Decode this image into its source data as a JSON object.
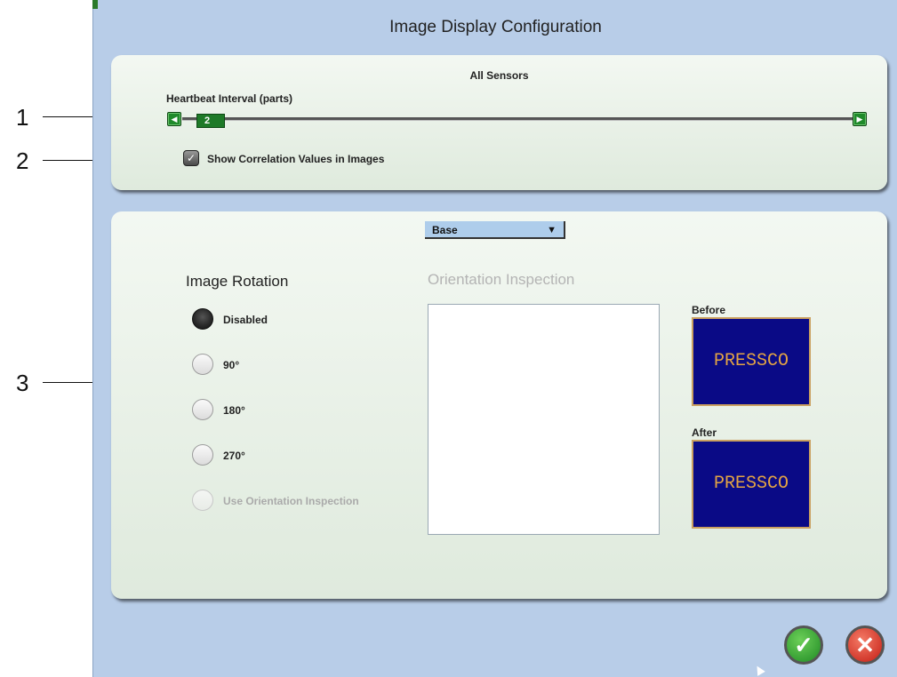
{
  "callouts": [
    "1",
    "2",
    "3"
  ],
  "dialog": {
    "title": "Image Display Configuration"
  },
  "sensors": {
    "section_title": "All Sensors",
    "heartbeat_label": "Heartbeat Interval (parts)",
    "heartbeat_value": "2",
    "show_correlation_label": "Show Correlation Values in Images",
    "show_correlation_checked": true
  },
  "rotation": {
    "dropdown_value": "Base",
    "heading": "Image Rotation",
    "options": [
      "Disabled",
      "90°",
      "180°",
      "270°",
      "Use Orientation Inspection"
    ],
    "selected": "Disabled",
    "orientation_heading": "Orientation Inspection",
    "before_label": "Before",
    "after_label": "After",
    "before_text": "PRESSCO",
    "after_text": "PRESSCO"
  },
  "colors": {
    "dialog_bg": "#b8cde8",
    "panel_bg": "#e8f0e6",
    "slider_green": "#1f8a2a",
    "image_bg": "#0a0a86",
    "image_text": "#e3a444",
    "ok_green": "#2e9a2a",
    "cancel_red": "#d42a1e"
  },
  "icons": {
    "slider_left": "chevron-left-icon",
    "slider_right": "chevron-right-icon",
    "ok": "check-icon",
    "cancel": "x-icon"
  },
  "footer": {
    "ok_glyph": "✓",
    "cancel_glyph": "✕"
  }
}
